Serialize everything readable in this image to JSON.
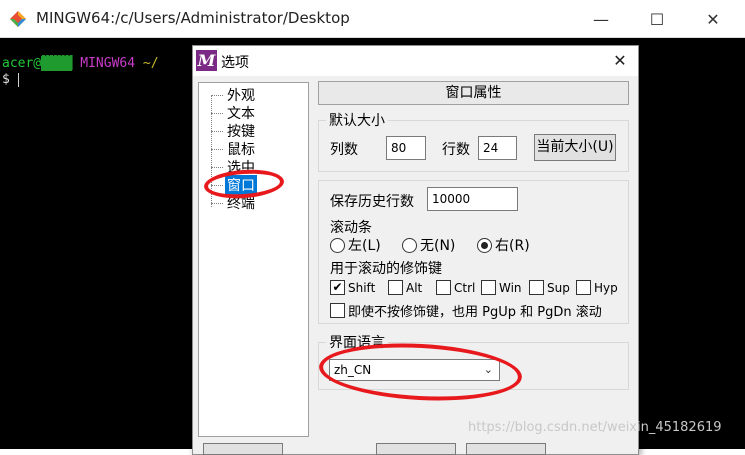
{
  "terminal": {
    "title": "MINGW64:/c/Users/Administrator/Desktop",
    "prompt_user": "acer@",
    "prompt_blocks": "▓▓▓▓",
    "prompt_host_label": "MINGW64",
    "prompt_path": "~/",
    "dollar": "$",
    "window_buttons": {
      "minimize": "—",
      "maximize": "☐",
      "close": "✕"
    }
  },
  "dialog": {
    "logo_letter": "M",
    "title": "选项",
    "close": "✕",
    "tree": [
      "外观",
      "文本",
      "按键",
      "鼠标",
      "选中",
      "窗口",
      "终端"
    ],
    "tree_selected_index": 5,
    "tab_label": "窗口属性",
    "default_size": {
      "group_label": "默认大小",
      "cols_label": "列数",
      "cols_value": "80",
      "rows_label": "行数",
      "rows_value": "24",
      "current_size_button": "当前大小(U)"
    },
    "scroll": {
      "history_label": "保存历史行数",
      "history_value": "10000",
      "scrollbar_label": "滚动条",
      "radio_left": "左(L)",
      "radio_none": "无(N)",
      "radio_right": "右(R)",
      "radio_selected": "right",
      "modifier_label": "用于滚动的修饰键",
      "checkboxes": [
        {
          "label": "Shift",
          "checked": true
        },
        {
          "label": "Alt",
          "checked": false
        },
        {
          "label": "Ctrl",
          "checked": false
        },
        {
          "label": "Win",
          "checked": false
        },
        {
          "label": "Sup",
          "checked": false
        },
        {
          "label": "Hyp",
          "checked": false
        }
      ],
      "pgupdn_label": "即使不按修饰键，也用 PgUp 和 PgDn 滚动",
      "pgupdn_checked": false
    },
    "language": {
      "group_label": "界面语言",
      "selected": "zh_CN"
    }
  },
  "watermark": "https://blog.csdn.net/weixin_45182619",
  "colors": {
    "highlight": "#e8191c",
    "selection": "#0078d7",
    "mintty_purple": "#7a2a85"
  }
}
